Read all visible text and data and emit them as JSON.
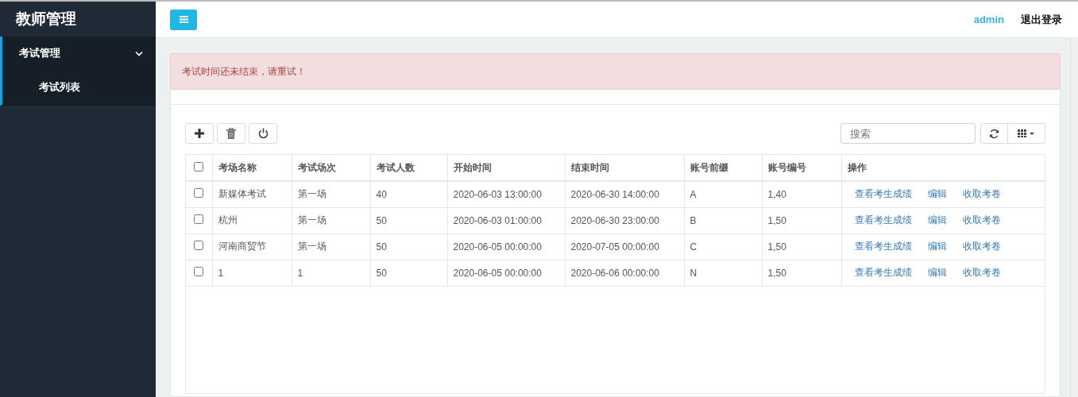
{
  "sidebar": {
    "title": "教师管理",
    "items": [
      {
        "label": "考试管理",
        "expanded": true,
        "selected": true,
        "children": [
          {
            "label": "考试列表",
            "selected": true
          }
        ]
      }
    ]
  },
  "topbar": {
    "user": "admin",
    "logout": "退出登录"
  },
  "alert": {
    "message": "考试时间还未结束，请重试！"
  },
  "search": {
    "placeholder": "搜索"
  },
  "table": {
    "columns": [
      "考场名称",
      "考试场次",
      "考试人数",
      "开始时间",
      "结束时间",
      "账号前缀",
      "账号编号",
      "操作"
    ],
    "header_checked": false,
    "rows": [
      {
        "checked": false,
        "cells": [
          "新媒体考试",
          "第一场",
          "40",
          "2020-06-03 13:00:00",
          "2020-06-30 14:00:00",
          "A",
          "1,40"
        ],
        "actions": [
          "查看考生成绩",
          "编辑",
          "收取考卷"
        ]
      },
      {
        "checked": false,
        "cells": [
          "杭州",
          "第一场",
          "50",
          "2020-06-03 01:00:00",
          "2020-06-30 23:00:00",
          "B",
          "1,50"
        ],
        "actions": [
          "查看考生成绩",
          "编辑",
          "收取考卷"
        ]
      },
      {
        "checked": false,
        "cells": [
          "河南商贸节",
          "第一场",
          "50",
          "2020-06-05 00:00:00",
          "2020-07-05 00:00:00",
          "C",
          "1,50"
        ],
        "actions": [
          "查看考生成绩",
          "编辑",
          "收取考卷"
        ]
      },
      {
        "checked": false,
        "cells": [
          "1",
          "1",
          "50",
          "2020-06-05 00:00:00",
          "2020-06-06 00:00:00",
          "N",
          "1,50"
        ],
        "actions": [
          "查看考生成绩",
          "编辑",
          "收取考卷"
        ]
      }
    ]
  }
}
